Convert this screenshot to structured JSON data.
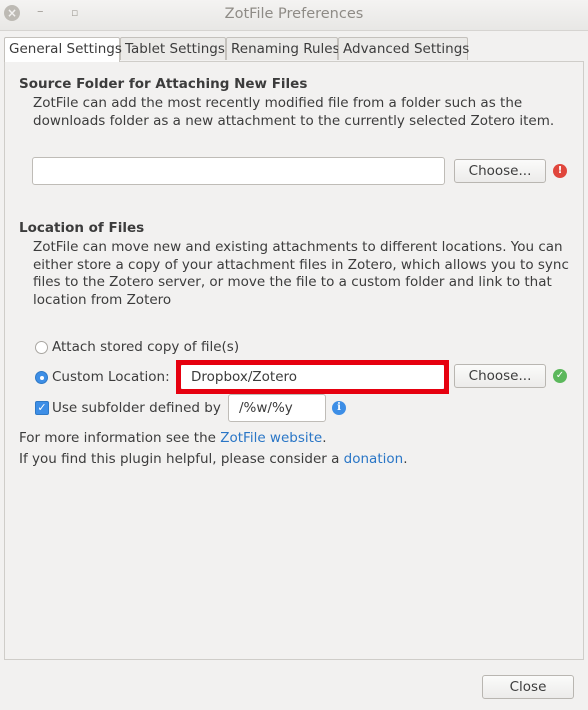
{
  "window": {
    "title": "ZotFile Preferences",
    "close_glyph": "×",
    "min_glyph": "–",
    "max_glyph": "▫"
  },
  "tabs": [
    {
      "label": "General Settings",
      "active": true
    },
    {
      "label": "Tablet Settings",
      "active": false
    },
    {
      "label": "Renaming Rules",
      "active": false
    },
    {
      "label": "Advanced Settings",
      "active": false
    }
  ],
  "source_folder": {
    "title": "Source Folder for Attaching New Files",
    "description_line1": "ZotFile can add the most recently modified file from a folder such as the",
    "description_line2": "downloads folder as a new attachment to the currently selected Zotero item.",
    "path_value": "",
    "choose_label": "Choose...",
    "status_icon": "error-icon",
    "status_glyph": "!"
  },
  "location": {
    "title": "Location of Files",
    "description_line1": "ZotFile can move new and existing attachments to different locations. You can",
    "description_line2": "either store a copy of your attachment files in Zotero, which allows you to sync",
    "description_line3": "files to the Zotero server, or move the file to a custom folder and link to that",
    "description_line4": "location from Zotero",
    "option_stored_label": "Attach stored copy of file(s)",
    "option_custom_label": "Custom Location:",
    "selected_option": "custom",
    "custom_path_value": "Dropbox/Zotero",
    "choose_label": "Choose...",
    "status_icon": "check-icon",
    "status_glyph": "✓",
    "subfolder_label": "Use subfolder defined by",
    "subfolder_checked": true,
    "subfolder_value": "/%w/%y",
    "info_glyph": "i"
  },
  "info": {
    "line1_prefix": "For more information see the ",
    "line1_link": "ZotFile website",
    "line1_suffix": ".",
    "line2_prefix": "If you find this plugin helpful, please consider a ",
    "line2_link": "donation",
    "line2_suffix": "."
  },
  "footer": {
    "close_label": "Close"
  },
  "colors": {
    "accent": "#3d8ee6",
    "link": "#2a76c6",
    "highlight": "#e6000f",
    "error": "#e0463c",
    "success": "#5cb85c"
  }
}
